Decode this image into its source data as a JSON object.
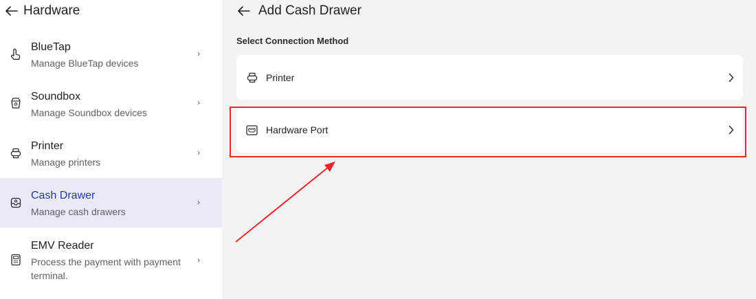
{
  "left": {
    "title": "Hardware",
    "items": [
      {
        "title": "BlueTap",
        "subtitle": "Manage BlueTap devices",
        "icon": "bluetap-icon"
      },
      {
        "title": "Soundbox",
        "subtitle": "Manage Soundbox devices",
        "icon": "soundbox-icon"
      },
      {
        "title": "Printer",
        "subtitle": "Manage printers",
        "icon": "printer-icon"
      },
      {
        "title": "Cash Drawer",
        "subtitle": "Manage cash drawers",
        "icon": "cash-drawer-icon"
      },
      {
        "title": "EMV Reader",
        "subtitle": "Process the payment with payment",
        "subtitle2": "terminal.",
        "icon": "emv-reader-icon"
      }
    ],
    "chevron": "›"
  },
  "right": {
    "title": "Add Cash Drawer",
    "section_label": "Select Connection Method",
    "options": [
      {
        "label": "Printer",
        "icon": "printer-icon"
      },
      {
        "label": "Hardware Port",
        "icon": "hardware-port-icon"
      }
    ]
  },
  "colors": {
    "active_bg": "#e9eaf4",
    "active_text": "#23379a",
    "annotation": "#e8262c"
  }
}
